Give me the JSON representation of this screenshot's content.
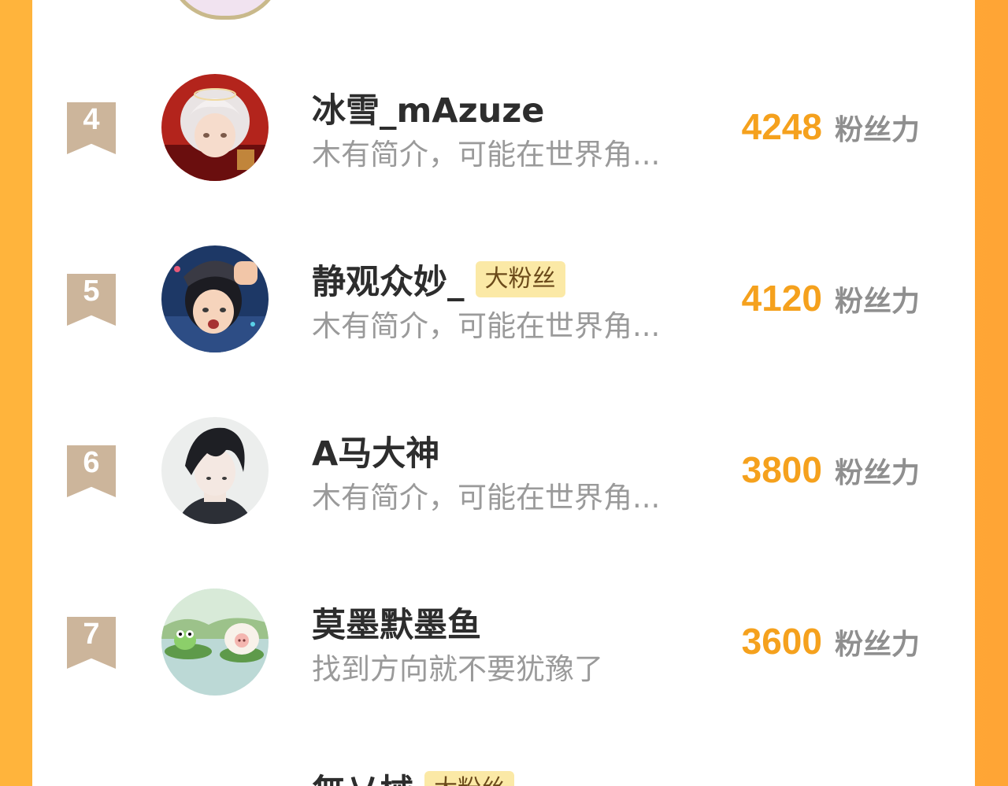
{
  "rows": [
    {
      "rank": "4",
      "name": "冰雪_mAzuze",
      "tag": "",
      "bio": "木有简介，可能在世界角...",
      "score": "4248",
      "unit": "粉丝力",
      "avatar": "avatar-white-hair-boy"
    },
    {
      "rank": "5",
      "name": "静观众妙_",
      "tag": "大粉丝",
      "bio": "木有简介，可能在世界角...",
      "score": "4120",
      "unit": "粉丝力",
      "avatar": "avatar-cap-boy"
    },
    {
      "rank": "6",
      "name": "A马大神",
      "tag": "",
      "bio": "木有简介，可能在世界角...",
      "score": "3800",
      "unit": "粉丝力",
      "avatar": "avatar-dark-hair-boy"
    },
    {
      "rank": "7",
      "name": "莫墨默墨鱼",
      "tag": "",
      "bio": "找到方向就不要犹豫了",
      "score": "3600",
      "unit": "粉丝力",
      "avatar": "avatar-frog-pig-scene"
    }
  ],
  "partial_next": {
    "name": "無乂械",
    "tag": "大粉丝"
  },
  "colors": {
    "accent": "#f5a11d",
    "badge": "#ccb59b",
    "tag_bg": "#fbe9a6",
    "side_bg": "#ffa535"
  }
}
